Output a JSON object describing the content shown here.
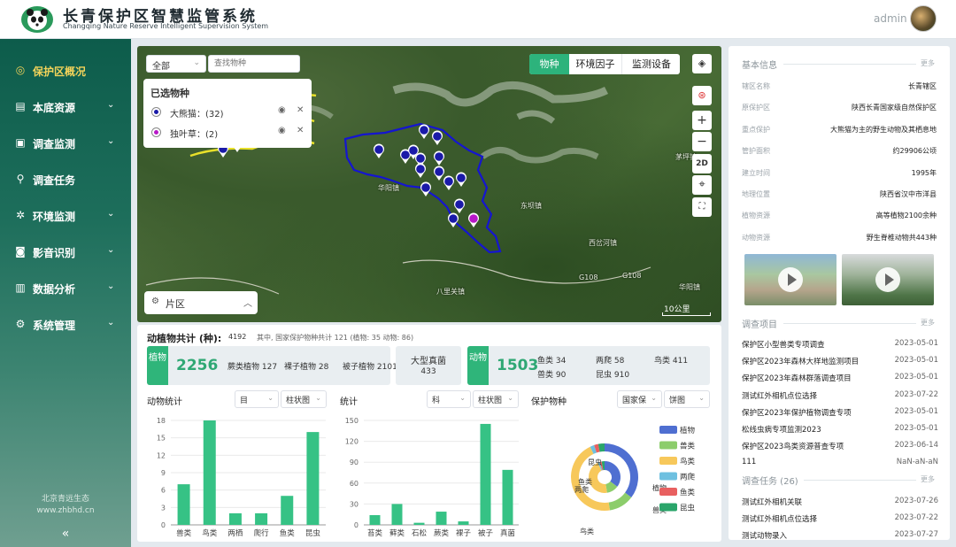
{
  "header": {
    "title_cn": "长青保护区智慧监管系统",
    "title_en": "Changqing Nature Reserve Intelligent Supervision System",
    "user": "admin"
  },
  "sidebar": {
    "items": [
      {
        "label": "保护区概况",
        "icon": "target-icon",
        "glyph": "◎",
        "active": true,
        "chevron": false
      },
      {
        "label": "本底资源",
        "icon": "resource-icon",
        "glyph": "▤",
        "active": false,
        "chevron": true
      },
      {
        "label": "调查监测",
        "icon": "monitor-icon",
        "glyph": "▣",
        "active": false,
        "chevron": true
      },
      {
        "label": "调查任务",
        "icon": "task-icon",
        "glyph": "⚲",
        "active": false,
        "chevron": false
      },
      {
        "label": "环境监测",
        "icon": "environment-icon",
        "glyph": "✲",
        "active": false,
        "chevron": true
      },
      {
        "label": "影音识别",
        "icon": "media-icon",
        "glyph": "◙",
        "active": false,
        "chevron": true
      },
      {
        "label": "数据分析",
        "icon": "analysis-icon",
        "glyph": "▥",
        "active": false,
        "chevron": true
      },
      {
        "label": "系统管理",
        "icon": "settings-icon",
        "glyph": "⚙",
        "active": false,
        "chevron": true
      }
    ],
    "company_name": "北京青远生态",
    "company_url": "www.zhbhd.cn",
    "collapse": "«"
  },
  "map": {
    "filter_value": "全部",
    "search_placeholder": "查找物种",
    "selected_title": "已选物种",
    "selected": [
      {
        "name": "大熊猫：(32)",
        "color": "#1a1aa8"
      },
      {
        "name": "独叶草：(2)",
        "color": "#b818c8"
      }
    ],
    "tabs": [
      "物种",
      "环境因子",
      "监测设备"
    ],
    "tools": [
      {
        "name": "layers",
        "glyph": "◈"
      },
      {
        "name": "compass",
        "glyph": "⊛"
      },
      {
        "name": "zoom-in",
        "glyph": "+"
      },
      {
        "name": "zoom-out",
        "glyph": "−"
      },
      {
        "name": "2d",
        "glyph": "2D"
      },
      {
        "name": "locate",
        "glyph": "⌖"
      },
      {
        "name": "fullscreen",
        "glyph": "⛶"
      }
    ],
    "zone_label": "片区",
    "scale_label": "10公里",
    "places": [
      "华阳镇",
      "东坝镇",
      "八里关镇",
      "茅坪镇",
      "西岔河镇",
      "华阳镇",
      "G108",
      "G108"
    ]
  },
  "stats": {
    "title": "动植物共计 (种):",
    "total": "4192",
    "note": "其中, 国家保护物种共计 121 (植物: 35  动物: 86)",
    "plant": {
      "tag": "植物",
      "total": "2256",
      "items": [
        {
          "label": "蕨类植物",
          "value": "127"
        },
        {
          "label": "裸子植物",
          "value": "28"
        },
        {
          "label": "被子植物",
          "value": "2101"
        }
      ]
    },
    "fungi": {
      "label": "大型真菌",
      "value": "433"
    },
    "animal": {
      "tag": "动物",
      "total": "1503",
      "items": [
        {
          "label": "鱼类",
          "value": "34"
        },
        {
          "label": "两爬",
          "value": "58"
        },
        {
          "label": "鸟类",
          "value": "411"
        },
        {
          "label": "兽类",
          "value": "90"
        },
        {
          "label": "昆虫",
          "value": "910"
        }
      ]
    }
  },
  "charts": {
    "animal": {
      "title": "动物统计",
      "dd1": "目",
      "dd2": "柱状图"
    },
    "plant": {
      "title": "统计",
      "dd1": "科",
      "dd2": "柱状图"
    },
    "protected": {
      "title": "保护物种",
      "dd1": "国家保",
      "dd2": "饼图"
    }
  },
  "chart_data": [
    {
      "type": "bar",
      "categories": [
        "兽类",
        "鸟类",
        "两栖",
        "爬行",
        "鱼类",
        "昆虫"
      ],
      "values": [
        7,
        18,
        2,
        2,
        5,
        16
      ],
      "ylim": [
        0,
        18
      ],
      "yticks": [
        0,
        3,
        6,
        9,
        12,
        15,
        18
      ],
      "color": "#36c285"
    },
    {
      "type": "bar",
      "categories": [
        "苔类",
        "藓类",
        "石松",
        "蕨类",
        "裸子",
        "被子",
        "真菌"
      ],
      "values": [
        14,
        30,
        3,
        19,
        5,
        145,
        79
      ],
      "ylim": [
        0,
        150
      ],
      "yticks": [
        0,
        30,
        60,
        90,
        120,
        150
      ],
      "color": "#36c285"
    },
    {
      "type": "pie",
      "legend": [
        {
          "name": "植物",
          "value": 35,
          "color": "#4f6fd1"
        },
        {
          "name": "兽类",
          "value": 12,
          "color": "#8ccd6b"
        },
        {
          "name": "鸟类",
          "value": 45,
          "color": "#f7c85b"
        },
        {
          "name": "两爬",
          "value": 2,
          "color": "#6ec0e0"
        },
        {
          "name": "鱼类",
          "value": 2,
          "color": "#e86060"
        },
        {
          "name": "昆虫",
          "value": 3,
          "color": "#2aa56a"
        }
      ],
      "outer_labels": [
        "昆虫",
        "植物",
        "兽类",
        "鸟类",
        "两爬",
        "鱼类"
      ],
      "inner_labels": [
        "鱼类",
        "两爬",
        "鸟类",
        "兽类",
        "植物",
        "昆虫",
        "鱼类",
        "两爬",
        "鸟类",
        "兽类",
        "植物",
        "昆虫"
      ]
    }
  ],
  "info": {
    "title": "基本信息",
    "more": "更多",
    "rows": [
      {
        "k": "辖区名称",
        "v": "长青辖区"
      },
      {
        "k": "原保护区",
        "v": "陕西长青国家级自然保护区"
      },
      {
        "k": "重点保护",
        "v": "大熊猫为主的野生动物及其栖息地"
      },
      {
        "k": "管护面积",
        "v": "约29906公顷"
      },
      {
        "k": "建立时间",
        "v": "1995年"
      },
      {
        "k": "地理位置",
        "v": "陕西省汉中市洋县"
      },
      {
        "k": "植物资源",
        "v": "高等植物2100余种"
      },
      {
        "k": "动物资源",
        "v": "野生脊椎动物共443种"
      }
    ]
  },
  "projects": {
    "title": "调查项目",
    "more": "更多",
    "rows": [
      {
        "n": "保护区小型兽类专项调查",
        "d": "2023-05-01"
      },
      {
        "n": "保护区2023年森林大样地监测项目",
        "d": "2023-05-01"
      },
      {
        "n": "保护区2023年森林群落调查项目",
        "d": "2023-05-01"
      },
      {
        "n": "测试红外相机点位选择",
        "d": "2023-07-22"
      },
      {
        "n": "保护区2023年保护植物调查专项",
        "d": "2023-05-01"
      },
      {
        "n": "松线虫病专项监测2023",
        "d": "2023-05-01"
      },
      {
        "n": "保护区2023鸟类资源普查专项",
        "d": "2023-06-14"
      },
      {
        "n": "111",
        "d": "NaN-aN-aN"
      }
    ]
  },
  "tasks": {
    "title": "调查任务 (26)",
    "more": "更多",
    "rows": [
      {
        "n": "测试红外相机关联",
        "d": "2023-07-26"
      },
      {
        "n": "测试红外相机点位选择",
        "d": "2023-07-22"
      },
      {
        "n": "测试动物录入",
        "d": "2023-07-27"
      }
    ]
  }
}
